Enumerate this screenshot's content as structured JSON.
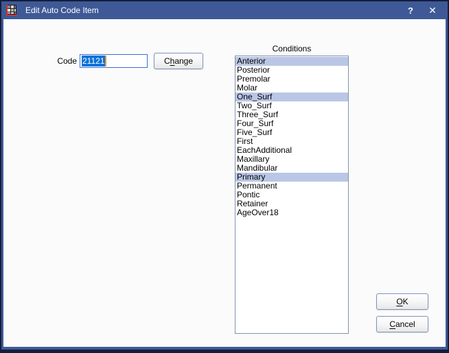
{
  "window": {
    "title": "Edit Auto Code Item",
    "help_label": "?",
    "close_label": "✕"
  },
  "code_field": {
    "label": "Code",
    "value": "21121"
  },
  "change_button": {
    "pre": "C",
    "mnemonic": "h",
    "post": "ange"
  },
  "ok_button": {
    "pre": "",
    "mnemonic": "O",
    "post": "K"
  },
  "cancel_button": {
    "pre": "",
    "mnemonic": "C",
    "post": "ancel"
  },
  "conditions": {
    "label": "Conditions",
    "items": [
      "Anterior",
      "Posterior",
      "Premolar",
      "Molar",
      "One_Surf",
      "Two_Surf",
      "Three_Surf",
      "Four_Surf",
      "Five_Surf",
      "First",
      "EachAdditional",
      "Maxillary",
      "Mandibular",
      "Primary",
      "Permanent",
      "Pontic",
      "Retainer",
      "AgeOver18"
    ],
    "selected_items": [
      "Anterior",
      "One_Surf",
      "Primary"
    ],
    "selected_indices": [
      0,
      4,
      13
    ]
  },
  "colors": {
    "titlebar": "#3e5996",
    "frame": "#141d3a",
    "selection_blue": "#0b72d8",
    "list_highlight": "#b9c6e6",
    "caret_orange": "#e8973c"
  }
}
